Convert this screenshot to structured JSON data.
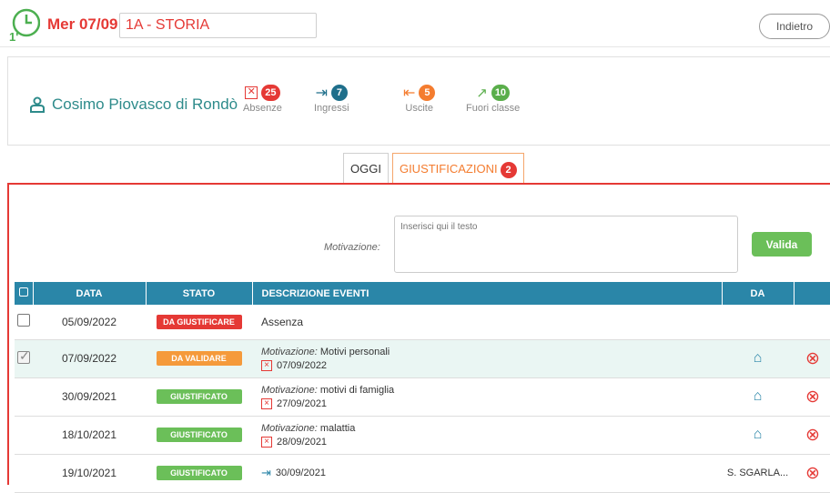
{
  "header": {
    "date": "Mer 07/09",
    "class_subject": "1A - STORIA",
    "back_label": "Indietro"
  },
  "student": {
    "name": "Cosimo Piovasco di Rondò",
    "stats": [
      {
        "label": "Absenze",
        "count": "25",
        "color": "#e53935"
      },
      {
        "label": "Ingressi",
        "count": "7",
        "color": "#1f6f8b"
      },
      {
        "label": "Uscite",
        "count": "5",
        "color": "#f47c2f"
      },
      {
        "label": "Fuori classe",
        "count": "10",
        "color": "#5aae4b"
      }
    ]
  },
  "tabs": {
    "oggi": "OGGI",
    "giustificazioni": "GIUSTIFICAZIONI",
    "giustificazioni_count": "2"
  },
  "form": {
    "motivazione_label": "Motivazione:",
    "placeholder": "Inserisci qui il testo",
    "valida_label": "Valida"
  },
  "table": {
    "headers": {
      "data": "DATA",
      "stato": "STATO",
      "descrizione": "DESCRIZIONE EVENTI",
      "da": "DA"
    },
    "rows": [
      {
        "date": "05/09/2022",
        "status": "DA GIUSTIFICARE",
        "status_color": "#e53935",
        "description": "Assenza"
      },
      {
        "date": "07/09/2022",
        "status": "DA VALIDARE",
        "status_color": "#f59a3b",
        "mot_label": "Motivazione:",
        "mot_text": " Motivi personali",
        "event_date": "07/09/2022"
      },
      {
        "date": "30/09/2021",
        "status": "GIUSTIFICATO",
        "status_color": "#6bbf59",
        "mot_label": "Motivazione:",
        "mot_text": " motivi di famiglia",
        "event_date": "27/09/2021"
      },
      {
        "date": "18/10/2021",
        "status": "GIUSTIFICATO",
        "status_color": "#6bbf59",
        "mot_label": "Motivazione:",
        "mot_text": " malattia",
        "event_date": "28/09/2021"
      },
      {
        "date": "19/10/2021",
        "status": "GIUSTIFICATO",
        "status_color": "#6bbf59",
        "event_date": "30/09/2021",
        "da": "S. SGARLA..."
      }
    ]
  }
}
